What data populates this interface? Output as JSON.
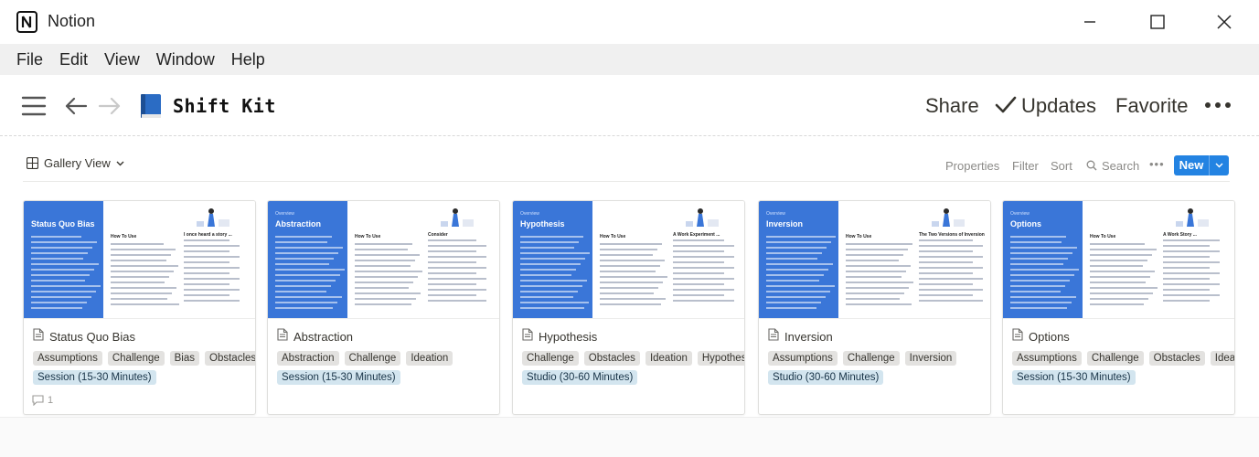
{
  "window": {
    "app_title": "Notion"
  },
  "menu": [
    "File",
    "Edit",
    "View",
    "Window",
    "Help"
  ],
  "topbar": {
    "page_title": "Shift Kit",
    "share": "Share",
    "updates": "Updates",
    "favorite": "Favorite"
  },
  "viewbar": {
    "view_name": "Gallery View",
    "properties": "Properties",
    "filter": "Filter",
    "sort": "Sort",
    "search": "Search",
    "new": "New"
  },
  "cards": [
    {
      "title": "Status Quo Bias",
      "cover_title": "Status Quo Bias",
      "cover_overline": "",
      "cover_head1": "How To Use",
      "cover_head2": "I once heard a story ...",
      "tags": [
        "Assumptions",
        "Challenge",
        "Bias",
        "Obstacles"
      ],
      "session": "Session (15-30 Minutes)",
      "comment_count": "1"
    },
    {
      "title": "Abstraction",
      "cover_title": "Abstraction",
      "cover_overline": "Overview",
      "cover_head1": "How To Use",
      "cover_head2": "Consider",
      "tags": [
        "Abstraction",
        "Challenge",
        "Ideation"
      ],
      "session": "Session (15-30 Minutes)",
      "comment_count": ""
    },
    {
      "title": "Hypothesis",
      "cover_title": "Hypothesis",
      "cover_overline": "Overview",
      "cover_head1": "How To Use",
      "cover_head2": "A Work Experiment ...",
      "tags": [
        "Challenge",
        "Obstacles",
        "Ideation",
        "Hypothesis"
      ],
      "session": "Studio (30-60 Minutes)",
      "comment_count": ""
    },
    {
      "title": "Inversion",
      "cover_title": "Inversion",
      "cover_overline": "Overview",
      "cover_head1": "How To Use",
      "cover_head2": "The Two Versions of Inversion",
      "tags": [
        "Assumptions",
        "Challenge",
        "Inversion"
      ],
      "session": "Studio (30-60 Minutes)",
      "comment_count": ""
    },
    {
      "title": "Options",
      "cover_title": "Options",
      "cover_overline": "Overview",
      "cover_head1": "How To Use",
      "cover_head2": "A Work Story ...",
      "tags": [
        "Assumptions",
        "Challenge",
        "Obstacles",
        "Ideation"
      ],
      "session": "Session (15-30 Minutes)",
      "comment_count": ""
    }
  ],
  "colors": {
    "accent": "#2383e2",
    "cover_blue": "#3a76d8",
    "tag_gray": "#e3e2e0",
    "tag_blue": "#d3e5ef"
  },
  "icons": {
    "app": "notion-logo-icon",
    "menu": "hamburger-menu-icon",
    "back": "arrow-left-icon",
    "forward": "arrow-right-icon",
    "page": "blue-book-icon",
    "updates": "checkmark-icon",
    "more": "more-dots-icon",
    "gallery": "gallery-grid-icon",
    "page_item": "page-doc-icon",
    "comment": "comment-icon",
    "search": "search-icon"
  }
}
